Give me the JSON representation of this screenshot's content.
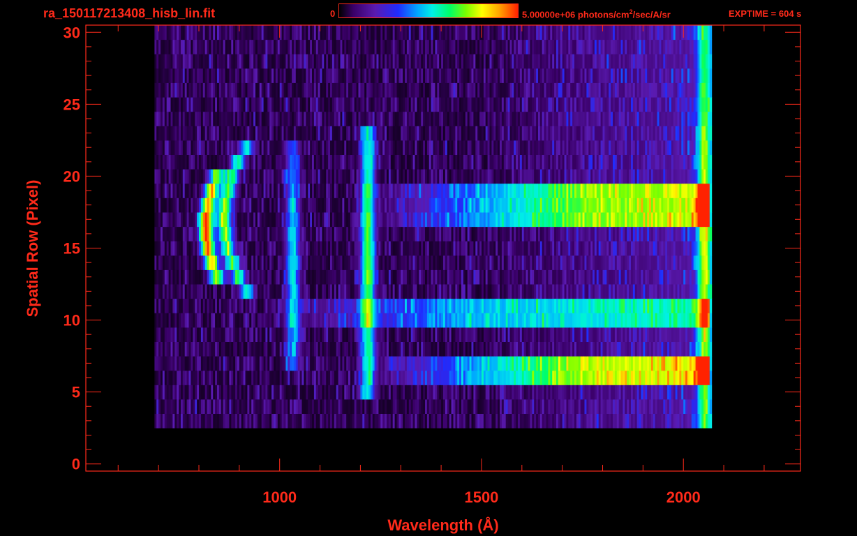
{
  "header": {
    "filename": "ra_150117213408_hisb_lin.fit",
    "colorbar_min": "0",
    "colorbar_max_prefix": "5.00000e+06 photons/cm",
    "colorbar_max_sup": "2",
    "colorbar_max_suffix": "/sec/A/sr",
    "exptime": "EXPTIME = 604 s"
  },
  "colors": {
    "axis": "#ff2a1a",
    "background": "#000000",
    "colormap": [
      "#000000",
      "#3a0068",
      "#5a1ab0",
      "#1f2cff",
      "#00a8ff",
      "#00f0e6",
      "#00ff66",
      "#7bff00",
      "#ffff00",
      "#ffa000",
      "#ff2200"
    ]
  },
  "chart_data": {
    "type": "heatmap",
    "title": "ra_150117213408_hisb_lin.fit",
    "xlabel": "Wavelength (Å)",
    "ylabel": "Spatial Row (Pixel)",
    "xlim": [
      520,
      2290
    ],
    "ylim": [
      -0.5,
      30.5
    ],
    "xticks": [
      1000,
      1500,
      2000
    ],
    "yticks": [
      0,
      5,
      10,
      15,
      20,
      25,
      30
    ],
    "colorbar_range": [
      0,
      5000000
    ],
    "colorbar_unit": "photons/cm^2/sec/A/sr",
    "data_extent": {
      "x_min": 690,
      "x_max": 2060,
      "row_min": 3,
      "row_max": 30
    },
    "features": [
      {
        "name": "curved emission arc (strong)",
        "x_center": 815,
        "rows": [
          13,
          20
        ],
        "peak_intensity": 0.97
      },
      {
        "name": "curved emission arc",
        "x_center": 860,
        "rows": [
          12,
          22
        ],
        "peak_intensity": 0.66
      },
      {
        "name": "emission line",
        "x_center": 1030,
        "rows": [
          7,
          22
        ],
        "peak_intensity": 0.4
      },
      {
        "name": "emission line",
        "x_center": 1216,
        "rows": [
          5,
          23
        ],
        "peak_intensity": 0.62
      },
      {
        "name": "continuum band",
        "rows": [
          17,
          19
        ],
        "x_range": [
          1450,
          2060
        ],
        "peak_intensity": 0.55
      },
      {
        "name": "continuum band",
        "rows": [
          6,
          7
        ],
        "x_range": [
          1450,
          2060
        ],
        "peak_intensity": 0.6
      },
      {
        "name": "continuum band",
        "rows": [
          10,
          11
        ],
        "x_range": [
          1200,
          2060
        ],
        "peak_intensity": 0.35
      },
      {
        "name": "edge column",
        "x_center": 2050,
        "rows": [
          0,
          30
        ],
        "peak_intensity": 0.6
      }
    ]
  }
}
